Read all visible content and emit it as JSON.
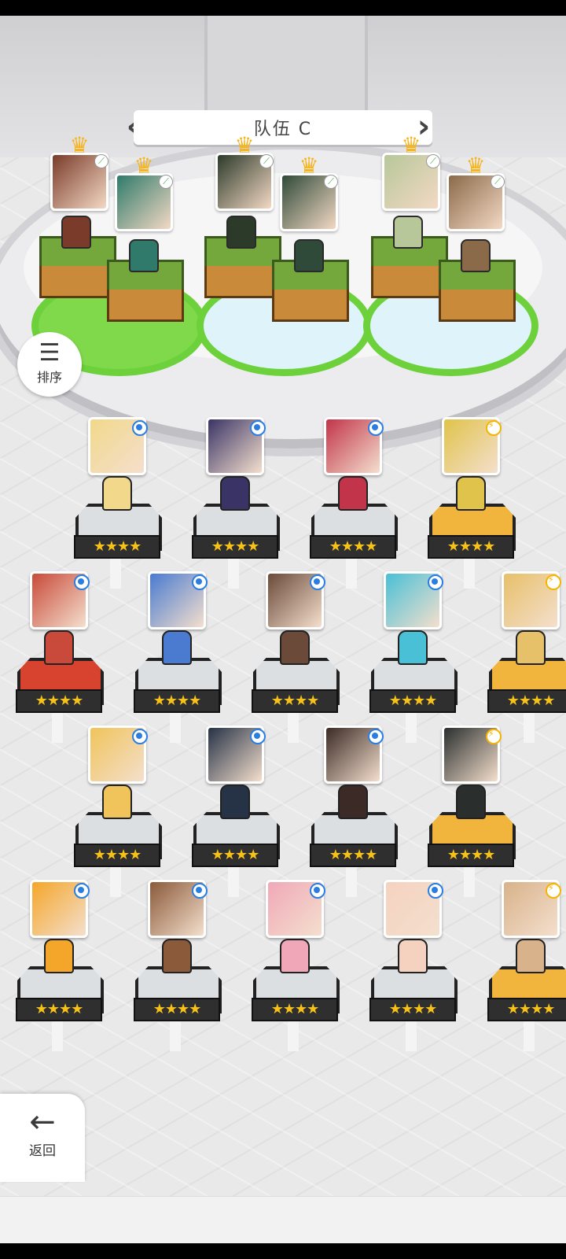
{
  "team": {
    "title": "队伍 C",
    "prev_icon": "chevron-left-icon",
    "next_icon": "chevron-right-icon",
    "slots": [
      {
        "pad": "green",
        "heroes": [
          {
            "color": "#7a3b2a",
            "crown": true,
            "element": "nature"
          },
          {
            "color": "#2f7a6a",
            "crown": true,
            "element": "nature"
          }
        ]
      },
      {
        "pad": "blue",
        "heroes": [
          {
            "color": "#2c3a2a",
            "crown": true,
            "element": "nature"
          },
          {
            "color": "#2f4a38",
            "crown": true,
            "element": "nature"
          }
        ]
      },
      {
        "pad": "blue",
        "heroes": [
          {
            "color": "#b7c79a",
            "crown": true,
            "element": "nature"
          },
          {
            "color": "#8b6a4a",
            "crown": true,
            "element": "nature"
          }
        ]
      }
    ]
  },
  "sort": {
    "label": "排序",
    "icon": "sort-icon"
  },
  "back": {
    "label": "返回",
    "icon": "back-arrow-icon"
  },
  "roster": {
    "stars": "★★★★",
    "rows": [
      [
        {
          "color": "#f2d88a",
          "element": "water",
          "base": "silver"
        },
        {
          "color": "#3a3466",
          "element": "water",
          "base": "silver"
        },
        {
          "color": "#c2344a",
          "element": "water",
          "base": "silver"
        },
        {
          "color": "#e0c34a",
          "element": "light",
          "base": "gold"
        }
      ],
      [
        {
          "color": "#c94a3a",
          "element": "fire",
          "base": "red"
        },
        {
          "color": "#4a7bd0",
          "element": "water",
          "base": "silver"
        },
        {
          "color": "#6b4a3a",
          "element": "water",
          "base": "silver"
        },
        {
          "color": "#49c0d6",
          "element": "water",
          "base": "silver"
        },
        {
          "color": "#e7c06a",
          "element": "light",
          "base": "gold"
        }
      ],
      [
        {
          "color": "#f0c45a",
          "element": "water",
          "base": "silver"
        },
        {
          "color": "#263246",
          "element": "water",
          "base": "silver"
        },
        {
          "color": "#3b2a26",
          "element": "water",
          "base": "silver"
        },
        {
          "color": "#2a2f2e",
          "element": "light",
          "base": "gold"
        }
      ],
      [
        {
          "color": "#f4a62a",
          "element": "water",
          "base": "silver"
        },
        {
          "color": "#8a5a3a",
          "element": "water",
          "base": "silver"
        },
        {
          "color": "#f0a8b8",
          "element": "water",
          "base": "silver"
        },
        {
          "color": "#f5d2c0",
          "element": "water",
          "base": "silver"
        },
        {
          "color": "#d8b28a",
          "element": "light",
          "base": "gold"
        }
      ]
    ]
  }
}
